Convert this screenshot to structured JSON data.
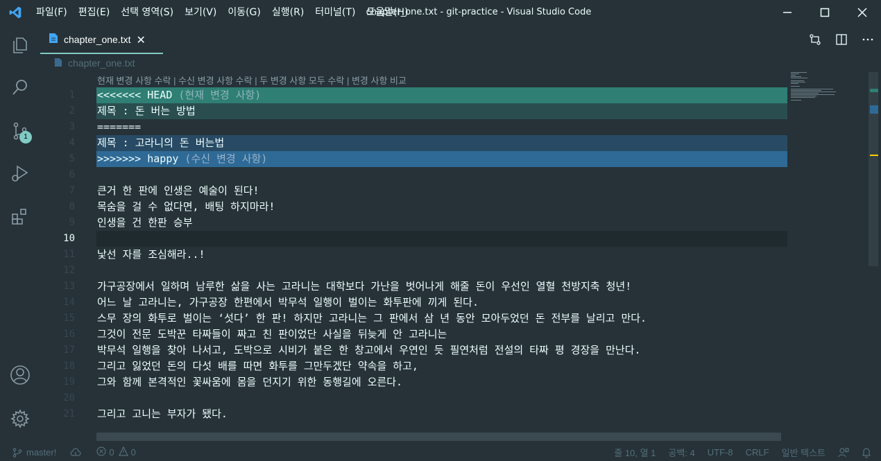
{
  "window": {
    "title": "chapter_one.txt - git-practice - Visual Studio Code"
  },
  "menu": [
    {
      "label": "파일(F)"
    },
    {
      "label": "편집(E)"
    },
    {
      "label": "선택 영역(S)"
    },
    {
      "label": "보기(V)"
    },
    {
      "label": "이동(G)"
    },
    {
      "label": "실행(R)"
    },
    {
      "label": "터미널(T)"
    },
    {
      "label": "도움말(H)"
    }
  ],
  "activity": {
    "scm_badge": "1",
    "icons": [
      "explorer-icon",
      "search-icon",
      "source-control-icon",
      "run-debug-icon",
      "extensions-icon",
      "account-icon",
      "settings-gear-icon"
    ]
  },
  "tab": {
    "label": "chapter_one.txt"
  },
  "breadcrumb": {
    "file": "chapter_one.txt"
  },
  "codelens": {
    "accept_current": "현재 변경 사항 수락",
    "accept_incoming": "수신 변경 사항 수락",
    "accept_both": "두 변경 사항 모두 수락",
    "compare": "변경 사항 비교",
    "sep": " | "
  },
  "editor": {
    "active_line": 10,
    "lines": [
      {
        "n": "1",
        "text": "<<<<<<< HEAD",
        "suffix": " (현재 변경 사항)",
        "kind": "current-header"
      },
      {
        "n": "2",
        "text": "제목 : 돈 버는 방법",
        "kind": "current-body"
      },
      {
        "n": "3",
        "text": "=======",
        "kind": "separator"
      },
      {
        "n": "4",
        "text": "제목 : 고라니의 돈 버는법",
        "kind": "incoming-body"
      },
      {
        "n": "5",
        "text": ">>>>>>> happy",
        "suffix": " (수신 변경 사항)",
        "kind": "incoming-header"
      },
      {
        "n": "6",
        "text": "",
        "kind": "normal"
      },
      {
        "n": "7",
        "text": "큰거 한 판에 인생은 예술이 된다!",
        "kind": "normal"
      },
      {
        "n": "8",
        "text": "목숨을 걸 수 없다면, 배팅 하지마라!",
        "kind": "normal"
      },
      {
        "n": "9",
        "text": "인생을 건 한판 승부",
        "kind": "normal"
      },
      {
        "n": "10",
        "text": "",
        "kind": "active"
      },
      {
        "n": "11",
        "text": "낯선 자를 조심해라..!",
        "kind": "normal"
      },
      {
        "n": "12",
        "text": "",
        "kind": "normal"
      },
      {
        "n": "13",
        "text": "가구공장에서 일하며 남루한 삶을 사는 고라니는 대학보다 가난을 벗어나게 해줄 돈이 우선인 열혈 천방지축 청년!",
        "kind": "normal"
      },
      {
        "n": "14",
        "text": "어느 날 고라니는, 가구공장 한편에서 박무석 일행이 벌이는 화투판에 끼게 된다.",
        "kind": "normal"
      },
      {
        "n": "15",
        "text": "스무 장의 화투로 벌이는 ‘섯다’ 한 판! 하지만 고라니는 그 판에서 삼 년 동안 모아두었던 돈 전부를 날리고 만다.",
        "kind": "normal"
      },
      {
        "n": "16",
        "text": "그것이 전문 도박꾼 타짜들이 짜고 친 판이었단 사실을 뒤늦게 안 고라니는",
        "kind": "normal"
      },
      {
        "n": "17",
        "text": "박무석 일행을 찾아 나서고, 도박으로 시비가 붙은 한 창고에서 우연인 듯 필연처럼 전설의 타짜 평 경장을 만난다.",
        "kind": "normal"
      },
      {
        "n": "18",
        "text": "그리고 잃었던 돈의 다섯 배를 따면 화투를 그만두겠단 약속을 하고,",
        "kind": "normal"
      },
      {
        "n": "19",
        "text": "그와 함께 본격적인 꽃싸움에 몸을 던지기 위한 동행길에 오른다.",
        "kind": "normal"
      },
      {
        "n": "20",
        "text": "",
        "kind": "normal"
      },
      {
        "n": "21",
        "text": "그리고 고니는 부자가 됐다.",
        "kind": "normal"
      }
    ]
  },
  "statusbar": {
    "branch": "master!",
    "errors": "0",
    "warnings": "0",
    "position": "줄 10, 열 1",
    "spaces": "공백: 4",
    "encoding": "UTF-8",
    "eol": "CRLF",
    "language": "일반 텍스트"
  },
  "colors": {
    "background": "#263238",
    "accent": "#80cbc4",
    "current_header": "#2f7f74",
    "current_body": "#2a4e4f",
    "incoming_body": "#284a64",
    "incoming_header": "#2f6a96"
  }
}
